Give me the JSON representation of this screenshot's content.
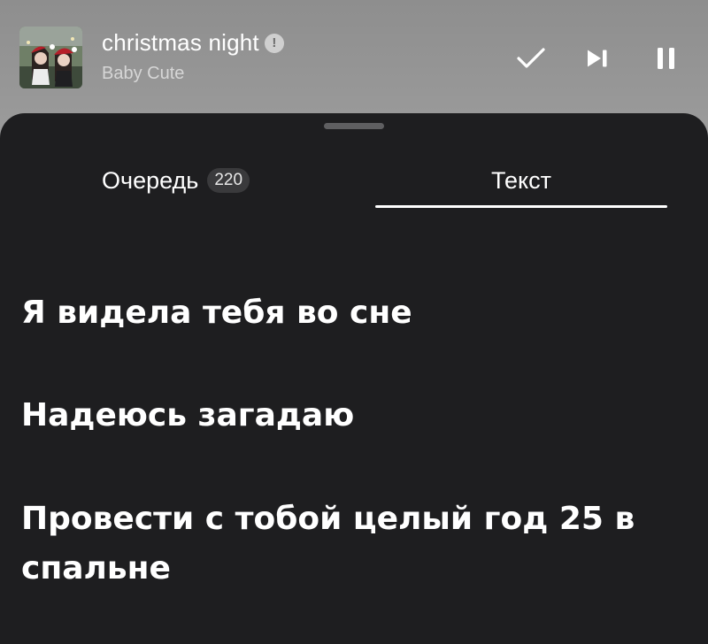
{
  "now_playing": {
    "title": "christmas night",
    "explicit_badge": "!",
    "artist": "Baby Cute",
    "cover_icon": "album-cover-photo"
  },
  "controls": {
    "like_icon": "checkmark-icon",
    "next_icon": "skip-next-icon",
    "pause_icon": "pause-icon"
  },
  "tabs": {
    "queue": {
      "label": "Очередь",
      "count": "220"
    },
    "lyrics": {
      "label": "Текст",
      "active": true
    }
  },
  "lyrics": [
    "Я видела тебя во сне",
    "Надеюсь загадаю",
    "Провести с тобой целый год 25 в спальне"
  ],
  "colors": {
    "sheet_background": "#1e1e20",
    "header_background": "#a0a0a0",
    "text_primary": "#ffffff",
    "text_secondary": "#d6d6d6",
    "badge_background": "#3a3a3c"
  }
}
